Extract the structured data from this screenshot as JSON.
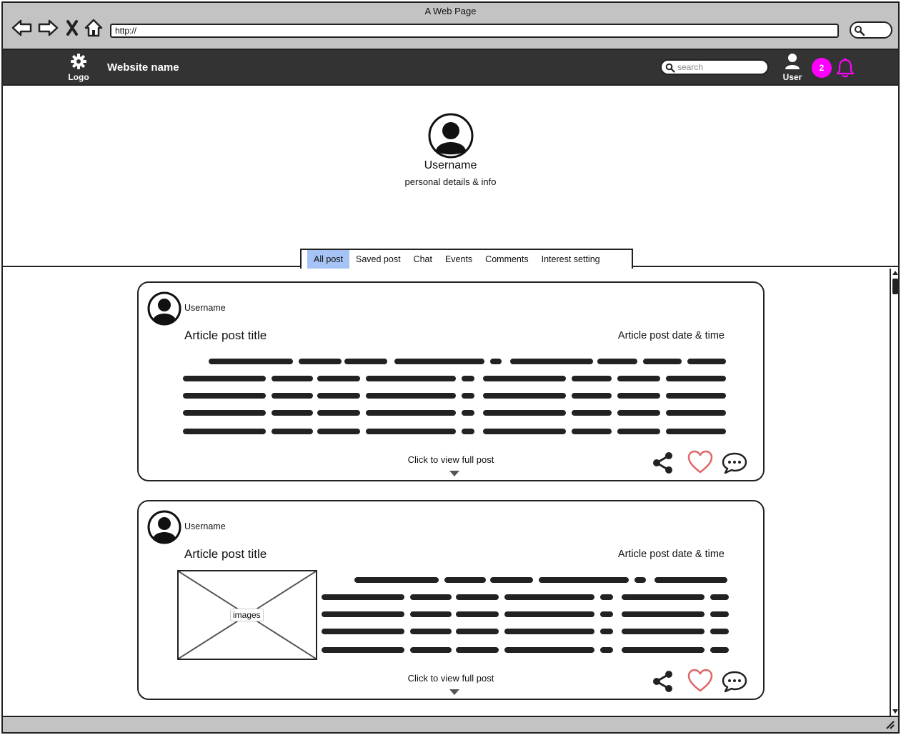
{
  "browser": {
    "window_title": "A Web Page",
    "address": "http://"
  },
  "app_nav": {
    "logo_label": "Logo",
    "site_name": "Website name",
    "search_placeholder": "search",
    "user_label": "User",
    "notification_count": "2",
    "accent_color": "#ff00ff"
  },
  "profile": {
    "username": "Username",
    "details": "personal details & info"
  },
  "tabs": [
    {
      "label": "All post",
      "active": true
    },
    {
      "label": "Saved post"
    },
    {
      "label": "Chat"
    },
    {
      "label": "Events"
    },
    {
      "label": "Comments"
    },
    {
      "label": "Interest setting"
    }
  ],
  "posts": [
    {
      "username": "Username",
      "title": "Article post title",
      "date": "Article post date & time",
      "view_full": "Click to view full post"
    },
    {
      "username": "Username",
      "title": "Article post title",
      "date": "Article post date & time",
      "image_label": "images",
      "view_full": "Click to view full post"
    }
  ],
  "icons": [
    "back-icon",
    "forward-icon",
    "stop-icon",
    "home-icon",
    "search-icon",
    "gear-icon",
    "user-icon",
    "bell-icon",
    "share-icon",
    "heart-icon",
    "comment-icon",
    "caret-down-icon"
  ]
}
